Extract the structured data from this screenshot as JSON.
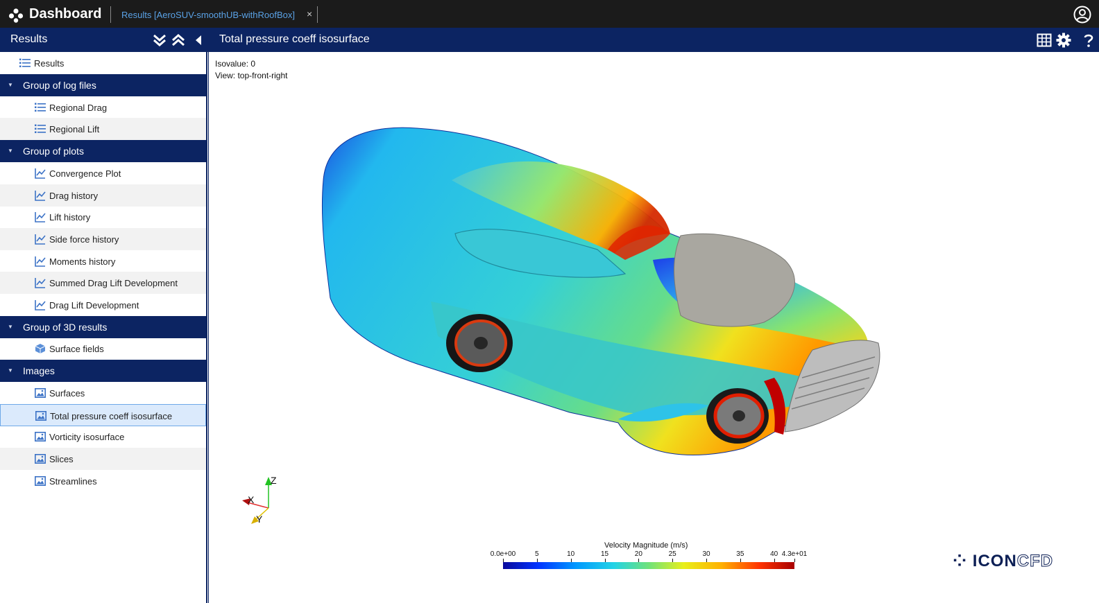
{
  "app": {
    "title": "Dashboard",
    "tab_label": "Results [AeroSUV-smoothUB-withRoofBox]",
    "tab_close": "×"
  },
  "subbar": {
    "panel_title": "Results",
    "content_title": "Total pressure coeff isosurface"
  },
  "sidebar": {
    "root": {
      "label": "Results",
      "icon": "list-icon"
    },
    "rows": [
      {
        "type": "group",
        "label": "Group of log files"
      },
      {
        "type": "item",
        "label": "Regional Drag",
        "icon": "list-icon"
      },
      {
        "type": "item",
        "label": "Regional Lift",
        "icon": "list-icon"
      },
      {
        "type": "group",
        "label": "Group of plots"
      },
      {
        "type": "item",
        "label": "Convergence Plot",
        "icon": "chart-line-icon"
      },
      {
        "type": "item",
        "label": "Drag history",
        "icon": "chart-line-icon"
      },
      {
        "type": "item",
        "label": "Lift history",
        "icon": "chart-line-icon"
      },
      {
        "type": "item",
        "label": "Side force history",
        "icon": "chart-line-icon"
      },
      {
        "type": "item",
        "label": "Moments history",
        "icon": "chart-line-icon"
      },
      {
        "type": "item",
        "label": "Summed Drag Lift Development",
        "icon": "chart-line-icon"
      },
      {
        "type": "item",
        "label": "Drag Lift Development",
        "icon": "chart-line-icon"
      },
      {
        "type": "group",
        "label": "Group of 3D results"
      },
      {
        "type": "item",
        "label": "Surface fields",
        "icon": "cube-icon"
      },
      {
        "type": "group",
        "label": "Images"
      },
      {
        "type": "item",
        "label": "Surfaces",
        "icon": "image-icon"
      },
      {
        "type": "item",
        "label": "Total pressure coeff isosurface",
        "icon": "image-icon",
        "selected": true
      },
      {
        "type": "item",
        "label": "Vorticity isosurface",
        "icon": "image-icon"
      },
      {
        "type": "item",
        "label": "Slices",
        "icon": "image-icon"
      },
      {
        "type": "item",
        "label": "Streamlines",
        "icon": "image-icon"
      }
    ]
  },
  "viewer": {
    "isovalue_text": "Isovalue: 0",
    "view_text": "View: top-front-right",
    "axes": {
      "z": "Z",
      "x": "X",
      "y": "Y"
    },
    "legend": {
      "title": "Velocity Magnitude (m/s)",
      "ticks": [
        "0.0e+00",
        "5",
        "10",
        "15",
        "20",
        "25",
        "30",
        "35",
        "40",
        "4.3e+01"
      ],
      "tick_values": [
        0,
        5,
        10,
        15,
        20,
        25,
        30,
        35,
        40,
        43
      ],
      "max": 43
    },
    "brand": {
      "part1": "ICON",
      "part2": "CFD"
    }
  },
  "colors": {
    "topbar": "#1b1b1b",
    "navy": "#0c2462",
    "tab_link": "#5aa2e6",
    "selected_row": "#dbeafc"
  }
}
